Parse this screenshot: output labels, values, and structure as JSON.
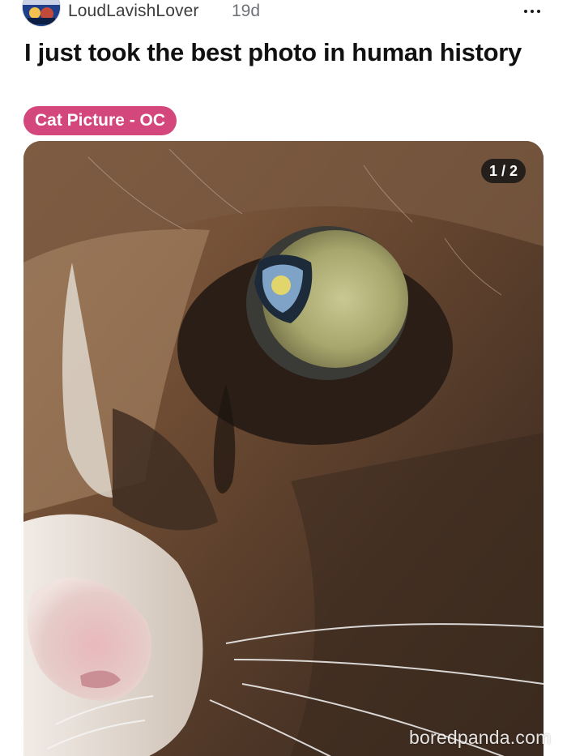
{
  "post": {
    "author": "LoudLavishLover",
    "age": "19d",
    "title": "I just took the best photo in human history",
    "flair": {
      "label": "Cat Picture - OC",
      "color": "#d4477c"
    },
    "media": {
      "counter": "1 / 2",
      "current_index": 1,
      "total": 2
    }
  },
  "icons": {
    "more": "more-horizontal-icon"
  },
  "watermark": "boredpanda.com"
}
